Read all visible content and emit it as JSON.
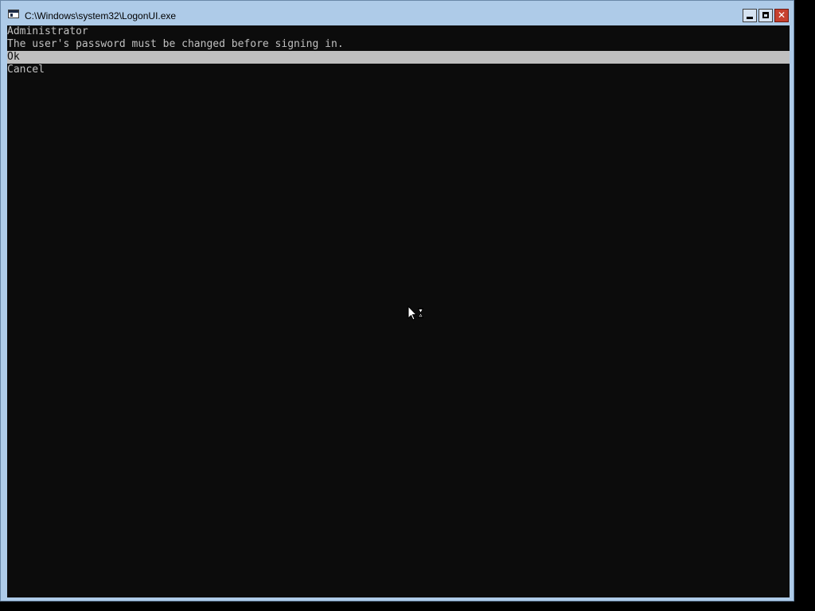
{
  "window": {
    "title": "C:\\Windows\\system32\\LogonUI.exe",
    "icon": "console-app-icon",
    "controls": {
      "minimize": "minimize-icon",
      "maximize": "maximize-icon",
      "close": "close-icon",
      "close_glyph": "✕"
    }
  },
  "console": {
    "username": "Administrator",
    "message": "The user's password must be changed before signing in.",
    "options": [
      {
        "label": "Ok",
        "selected": true
      },
      {
        "label": "Cancel",
        "selected": false
      }
    ]
  },
  "colors": {
    "titlebar": "#aecbe8",
    "console_bg": "#0c0c0c",
    "console_fg": "#c0c0c0",
    "selection_bg": "#c0c0c0",
    "close_button": "#c7412f"
  },
  "cursor": {
    "icon": "busy-arrow-cursor-icon"
  }
}
